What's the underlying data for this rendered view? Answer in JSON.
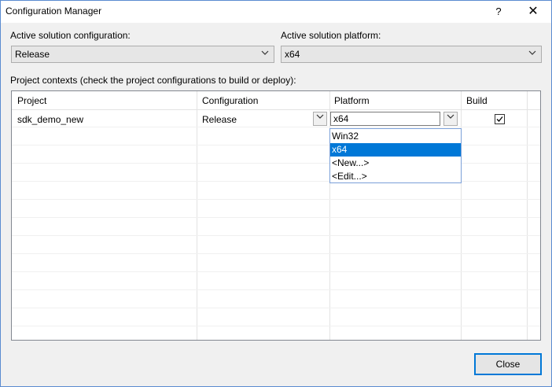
{
  "window": {
    "title": "Configuration Manager",
    "help_glyph": "?",
    "close_glyph": "✕"
  },
  "active_config": {
    "label": "Active solution configuration:",
    "value": "Release"
  },
  "active_platform": {
    "label": "Active solution platform:",
    "value": "x64"
  },
  "project_contexts": {
    "label": "Project contexts (check the project configurations to build or deploy):",
    "columns": [
      "Project",
      "Configuration",
      "Platform",
      "Build"
    ],
    "rows": [
      {
        "project": "sdk_demo_new",
        "configuration": "Release",
        "platform": "x64",
        "build": true
      }
    ]
  },
  "platform_dropdown": {
    "options": [
      "Win32",
      "x64",
      "<New...>",
      "<Edit...>"
    ],
    "selected": "x64"
  },
  "icons": {
    "combo_arrow": "chevron-down-icon",
    "checkmark": "checkmark-icon"
  },
  "footer": {
    "close_label": "Close"
  },
  "colors": {
    "selection": "#0078d7",
    "border_accent": "#0078d7"
  }
}
